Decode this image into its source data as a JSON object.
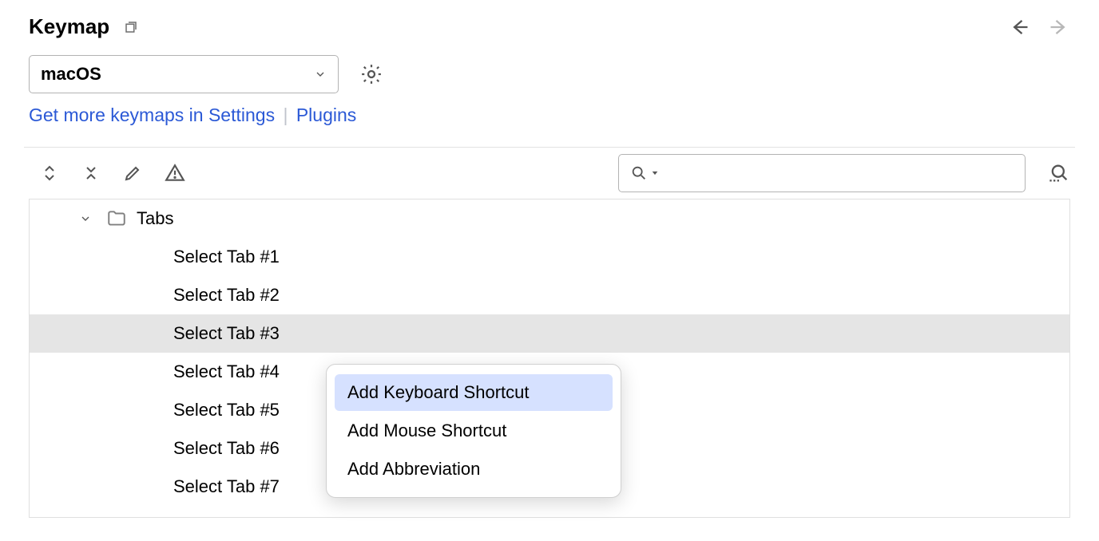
{
  "header": {
    "title": "Keymap"
  },
  "keymap": {
    "selected": "macOS",
    "link_text_a": "Get more keymaps in Settings",
    "link_text_b": "Plugins"
  },
  "tree": {
    "folder_label": "Tabs",
    "items": [
      "Select Tab #1",
      "Select Tab #2",
      "Select Tab #3",
      "Select Tab #4",
      "Select Tab #5",
      "Select Tab #6",
      "Select Tab #7"
    ],
    "selected_index": 2
  },
  "context_menu": {
    "items": [
      "Add Keyboard Shortcut",
      "Add Mouse Shortcut",
      "Add Abbreviation"
    ],
    "highlighted_index": 0
  }
}
